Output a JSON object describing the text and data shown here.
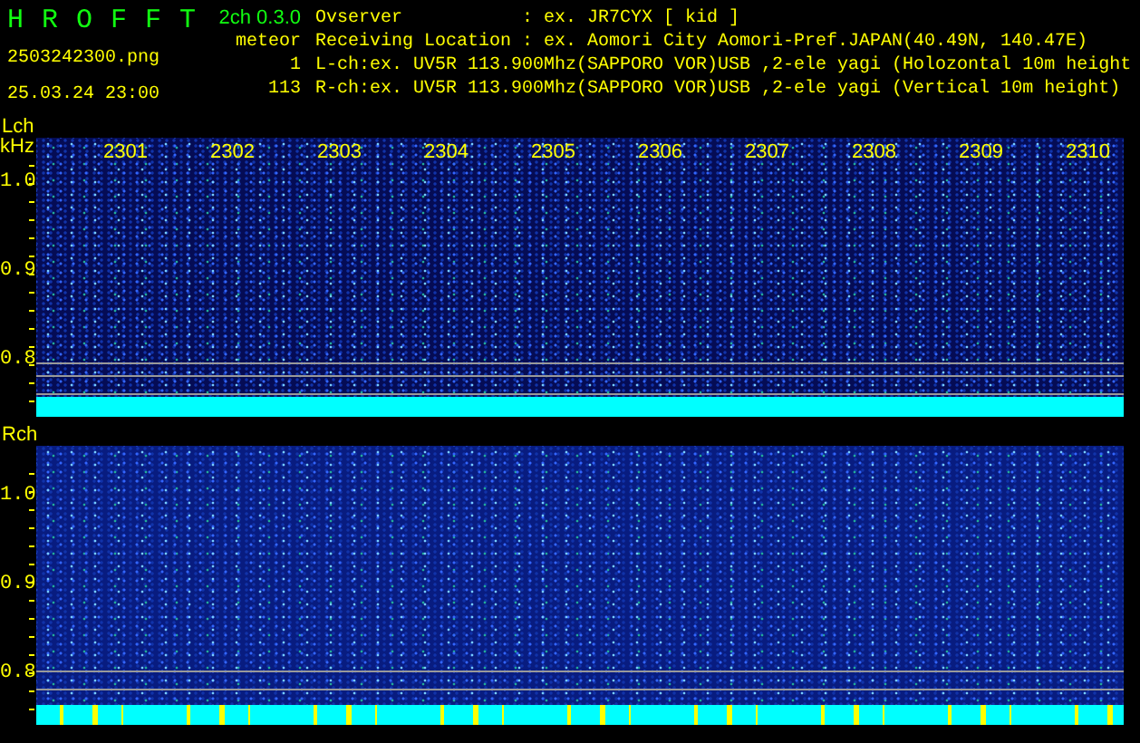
{
  "app": {
    "title": "H R O F F T",
    "version": "2ch 0.3.0"
  },
  "file": {
    "name": "2503242300.png",
    "datetime": "25.03.24 23:00"
  },
  "meteor": {
    "label": "meteor",
    "counts": [
      "1",
      "113"
    ]
  },
  "station": [
    {
      "label": "Ovserver",
      "value": ": ex. JR7CYX [ kid ]"
    },
    {
      "label": "Receiving Location",
      "value": ": ex. Aomori City Aomori-Pref.JAPAN(40.49N, 140.47E)"
    }
  ],
  "channel_lines": [
    "L-ch:ex. UV5R 113.900Mhz(SAPPORO VOR)USB ,2-ele yagi (Holozontal 10m height",
    "R-ch:ex. UV5R 113.900Mhz(SAPPORO VOR)USB ,2-ele yagi (Vertical 10m height)"
  ],
  "panels": [
    {
      "label": "Lch",
      "unit": "kHz",
      "time_labels": [
        "2301",
        "2302",
        "2303",
        "2304",
        "2305",
        "2306",
        "2307",
        "2308",
        "2309",
        "2310"
      ],
      "y_labels": [
        "1.0",
        "0.9",
        "0.8"
      ]
    },
    {
      "label": "Rch",
      "y_labels": [
        "1.0",
        "0.9",
        "0.8"
      ]
    }
  ]
}
